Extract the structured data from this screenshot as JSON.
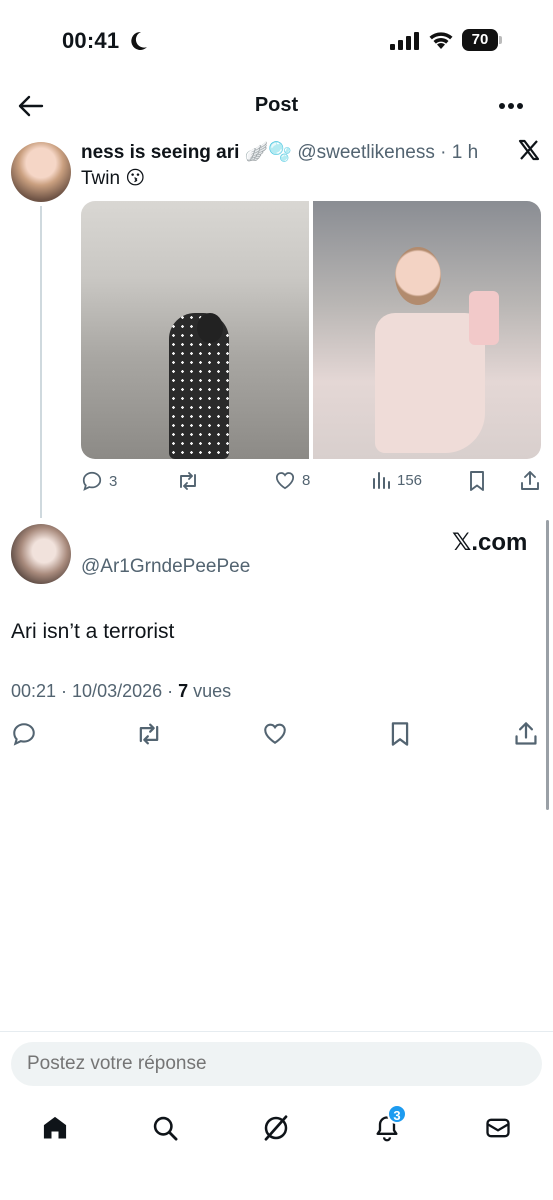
{
  "status_bar": {
    "time": "00:41",
    "battery": "70"
  },
  "header": {
    "title": "Post"
  },
  "quoted_post": {
    "author_name": "ness is seeing ari",
    "name_emojis": "🪽🫧",
    "handle": "@sweetlikeness",
    "separator": "·",
    "time": "1 h",
    "text": "Twin 😗",
    "stats": {
      "replies": "3",
      "likes": "8",
      "views": "156"
    }
  },
  "reply_post": {
    "handle": "@Ar1GrndePeePee",
    "watermark": "𝕏.com",
    "text": "Ari isn’t a terrorist",
    "meta_time": "00:21 · 10/03/2026 · ",
    "views_count": "7",
    "views_label": " vues"
  },
  "composer": {
    "placeholder": "Postez votre réponse"
  },
  "bottom_nav": {
    "notifications_badge": "3"
  },
  "colors": {
    "text": "#0f1419",
    "secondary": "#536471",
    "accent": "#1d9bf0",
    "input_bg": "#eff3f4"
  }
}
